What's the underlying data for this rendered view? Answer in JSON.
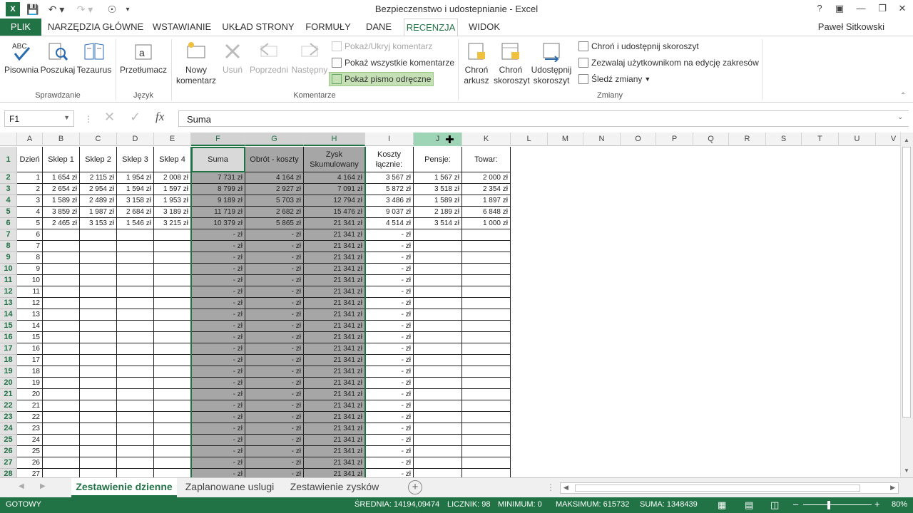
{
  "window": {
    "title": "Bezpieczenstwo i udostepnianie - Excel",
    "help": "?",
    "user": "Paweł Sitkowski"
  },
  "tabs": [
    "PLIK",
    "NARZĘDZIA GŁÓWNE",
    "WSTAWIANIE",
    "UKŁAD STRONY",
    "FORMUŁY",
    "DANE",
    "RECENZJA",
    "WIDOK"
  ],
  "ribbon": {
    "spell": "Pisownia",
    "research": "Poszukaj",
    "thesaurus": "Tezaurus",
    "g_proof": "Sprawdzanie",
    "translate": "Przetłumacz",
    "g_lang": "Język",
    "new_comment_1": "Nowy",
    "new_comment_2": "komentarz",
    "delete": "Usuń",
    "prev": "Poprzedni",
    "next": "Następny",
    "show_hide": "Pokaż/Ukryj komentarz",
    "show_all": "Pokaż wszystkie komentarze",
    "show_ink": "Pokaż pismo odręczne",
    "g_comments": "Komentarze",
    "protect_sheet_1": "Chroń",
    "protect_sheet_2": "arkusz",
    "protect_wb_1": "Chroń",
    "protect_wb_2": "skoroszyt",
    "share_wb_1": "Udostępnij",
    "share_wb_2": "skoroszyt",
    "protect_share": "Chroń i udostępnij skoroszyt",
    "allow_ranges": "Zezwalaj użytkownikom na edycję zakresów",
    "track": "Śledź zmiany",
    "g_changes": "Zmiany"
  },
  "formula": {
    "namebox": "F1",
    "content": "Suma"
  },
  "columns": [
    "A",
    "B",
    "C",
    "D",
    "E",
    "F",
    "G",
    "H",
    "I",
    "J",
    "K",
    "L",
    "M",
    "N",
    "O",
    "P",
    "Q",
    "R",
    "S",
    "T",
    "U",
    "V"
  ],
  "header_row": [
    "Dzień",
    "Sklep 1",
    "Sklep 2",
    "Sklep 3",
    "Sklep 4",
    "Suma",
    "Obrót - koszty",
    "Zysk Skumulowany",
    "Koszty łącznie:",
    "Pensje:",
    "Towar:"
  ],
  "data_rows": [
    [
      "1",
      "1 654 zł",
      "2 115 zł",
      "1 954 zł",
      "2 008 zł",
      "7 731 zł",
      "4 164 zł",
      "4 164 zł",
      "3 567 zł",
      "1 567 zł",
      "2 000 zł"
    ],
    [
      "2",
      "2 654 zł",
      "2 954 zł",
      "1 594 zł",
      "1 597 zł",
      "8 799 zł",
      "2 927 zł",
      "7 091 zł",
      "5 872 zł",
      "3 518 zł",
      "2 354 zł"
    ],
    [
      "3",
      "1 589 zł",
      "2 489 zł",
      "3 158 zł",
      "1 953 zł",
      "9 189 zł",
      "5 703 zł",
      "12 794 zł",
      "3 486 zł",
      "1 589 zł",
      "1 897 zł"
    ],
    [
      "4",
      "3 859 zł",
      "1 987 zł",
      "2 684 zł",
      "3 189 zł",
      "11 719 zł",
      "2 682 zł",
      "15 476 zł",
      "9 037 zł",
      "2 189 zł",
      "6 848 zł"
    ],
    [
      "5",
      "2 465 zł",
      "3 153 zł",
      "1 546 zł",
      "3 215 zł",
      "10 379 zł",
      "5 865 zł",
      "21 341 zł",
      "4 514 zł",
      "3 514 zł",
      "1 000 zł"
    ]
  ],
  "empty_value": "-   zł",
  "cumulative_value": "21 341 zł",
  "empty_days": [
    "6",
    "7",
    "8",
    "9",
    "10",
    "11",
    "12",
    "13",
    "14",
    "15",
    "16",
    "17",
    "18",
    "19",
    "20",
    "21",
    "22",
    "23",
    "24",
    "25",
    "26",
    "27"
  ],
  "row_numbers": [
    "1",
    "2",
    "3",
    "4",
    "5",
    "6",
    "7",
    "8",
    "9",
    "10",
    "11",
    "12",
    "13",
    "14",
    "15",
    "16",
    "17",
    "18",
    "19",
    "20",
    "21",
    "22",
    "23",
    "24",
    "25",
    "26",
    "27",
    "28"
  ],
  "sheets": [
    "Zestawienie dzienne",
    "Zaplanowane uslugi",
    "Zestawienie zysków"
  ],
  "status": {
    "ready": "GOTOWY",
    "avg": "ŚREDNIA: 14194,09474",
    "count": "LICZNIK: 98",
    "min": "MINIMUM: 0",
    "max": "MAKSIMUM: 615732",
    "sum": "SUMA: 1348439",
    "zoom": "80%"
  },
  "colors": {
    "accent": "#217346",
    "selected": "#a6a6a6"
  }
}
